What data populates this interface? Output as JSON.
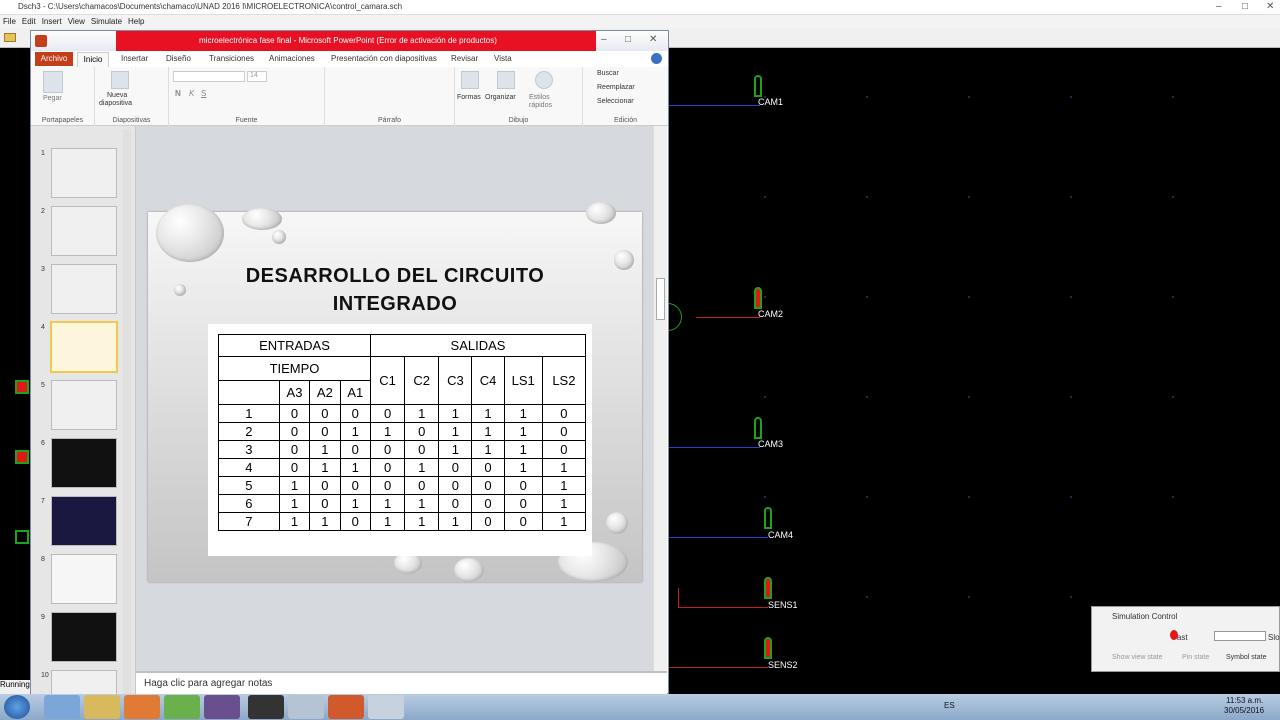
{
  "dsch": {
    "title": "Dsch3 - C:\\Users\\chamacos\\Documents\\chamaco\\UNAD 2016 I\\MICROELECTRONICA\\control_camara.sch",
    "menu": [
      "File",
      "Edit",
      "Insert",
      "View",
      "Simulate",
      "Help"
    ],
    "status": "Running",
    "labels": [
      "CAM1",
      "CAM2",
      "CAM3",
      "CAM4",
      "SENS1",
      "SENS2"
    ],
    "sim": {
      "title": "Simulation Control",
      "fast": "Fast",
      "sl": "Slo",
      "show_view_state": "Show view state",
      "pin_state": "Pin state",
      "symbol_state": "Symbol state"
    }
  },
  "ppt": {
    "title": "microelectrónica fase final  -  Microsoft PowerPoint (Error de activación de productos)",
    "tabs": [
      "Archivo",
      "Inicio",
      "Insertar",
      "Diseño",
      "Transiciones",
      "Animaciones",
      "Presentación con diapositivas",
      "Revisar",
      "Vista"
    ],
    "groups": {
      "portapapeles": "Portapapeles",
      "diapositivas": "Diapositivas",
      "fuente": "Fuente",
      "parrafo": "Párrafo",
      "dibujo": "Dibujo",
      "edicion": "Edición"
    },
    "buttons": {
      "pegar": "Pegar",
      "nueva": "Nueva",
      "diapositiva": "diapositiva",
      "formas": "Formas",
      "organizar": "Organizar",
      "estilos": "Estilos",
      "rapidos": "rápidos",
      "buscar": "Buscar",
      "reemplazar": "Reemplazar",
      "seleccionar": "Seleccionar"
    },
    "font_size": "14",
    "thumb_numbers": [
      "1",
      "2",
      "3",
      "4",
      "5",
      "6",
      "7",
      "8",
      "9",
      "10"
    ],
    "notes_placeholder": "Haga clic para agregar notas",
    "slide": {
      "title_line1": "DESARROLLO DEL CIRCUITO",
      "title_line2": "INTEGRADO",
      "table": {
        "entradas": "ENTRADAS",
        "salidas": "SALIDAS",
        "tiempo": "TIEMPO",
        "inputs": [
          "A3",
          "A2",
          "A1"
        ],
        "outputs": [
          "C1",
          "C2",
          "C3",
          "C4",
          "LS1",
          "LS2"
        ],
        "rows": [
          [
            "1",
            "0",
            "0",
            "0",
            "0",
            "1",
            "1",
            "1",
            "1",
            "0"
          ],
          [
            "2",
            "0",
            "0",
            "1",
            "1",
            "0",
            "1",
            "1",
            "1",
            "0"
          ],
          [
            "3",
            "0",
            "1",
            "0",
            "0",
            "0",
            "1",
            "1",
            "1",
            "0"
          ],
          [
            "4",
            "0",
            "1",
            "1",
            "0",
            "1",
            "0",
            "0",
            "1",
            "1"
          ],
          [
            "5",
            "1",
            "0",
            "0",
            "0",
            "0",
            "0",
            "0",
            "0",
            "1"
          ],
          [
            "6",
            "1",
            "0",
            "1",
            "1",
            "1",
            "0",
            "0",
            "0",
            "1"
          ],
          [
            "7",
            "1",
            "1",
            "0",
            "1",
            "1",
            "1",
            "0",
            "0",
            "1"
          ]
        ]
      }
    }
  },
  "taskbar": {
    "time": "11:53 a.m.",
    "date": "30/05/2016",
    "lang": "ES"
  }
}
